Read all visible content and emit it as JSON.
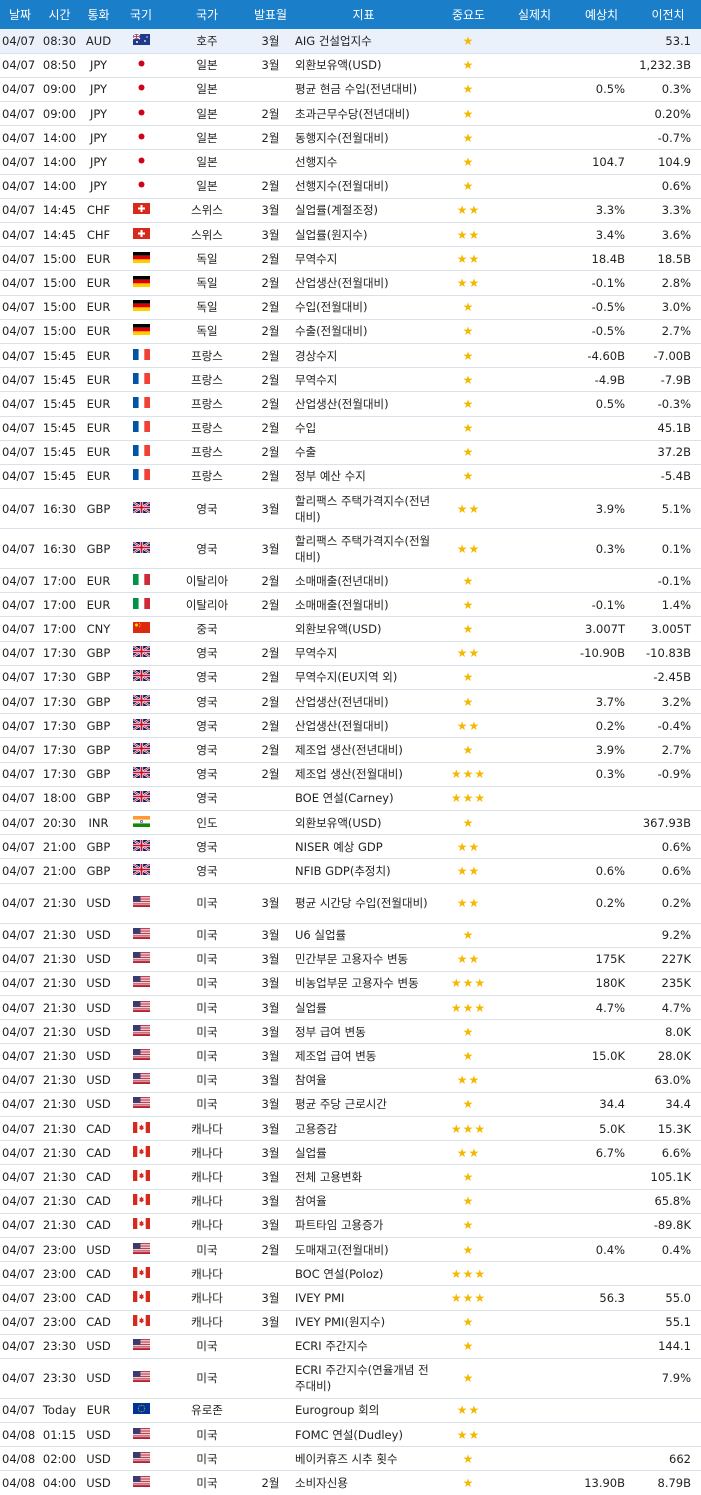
{
  "columns": [
    "날짜",
    "시간",
    "통화",
    "국기",
    "국가",
    "발표월",
    "지표",
    "중요도",
    "실제치",
    "예상치",
    "이전치"
  ],
  "flag_icons": {
    "AUD": "australia-flag-icon",
    "JPY": "japan-flag-icon",
    "CHF": "switzerland-flag-icon",
    "EUR_DE": "germany-flag-icon",
    "EUR_FR": "france-flag-icon",
    "GBP": "uk-flag-icon",
    "EUR_IT": "italy-flag-icon",
    "CNY": "china-flag-icon",
    "INR": "india-flag-icon",
    "USD": "usa-flag-icon",
    "CAD": "canada-flag-icon",
    "EUR_EU": "eu-flag-icon"
  },
  "rows": [
    {
      "date": "04/07",
      "time": "08:30",
      "cur": "AUD",
      "flag": "au",
      "country": "호주",
      "month": "3월",
      "ind": "AIG 건설업지수",
      "stars": 1,
      "actual": "",
      "forecast": "",
      "prev": "53.1",
      "hl": true
    },
    {
      "date": "04/07",
      "time": "08:50",
      "cur": "JPY",
      "flag": "jp",
      "country": "일본",
      "month": "3월",
      "ind": "외환보유액(USD)",
      "stars": 1,
      "actual": "",
      "forecast": "",
      "prev": "1,232.3B"
    },
    {
      "date": "04/07",
      "time": "09:00",
      "cur": "JPY",
      "flag": "jp",
      "country": "일본",
      "month": "",
      "ind": "평균 현금 수입(전년대비)",
      "stars": 1,
      "actual": "",
      "forecast": "0.5%",
      "prev": "0.3%"
    },
    {
      "date": "04/07",
      "time": "09:00",
      "cur": "JPY",
      "flag": "jp",
      "country": "일본",
      "month": "2월",
      "ind": "초과근무수당(전년대비)",
      "stars": 1,
      "actual": "",
      "forecast": "",
      "prev": "0.20%"
    },
    {
      "date": "04/07",
      "time": "14:00",
      "cur": "JPY",
      "flag": "jp",
      "country": "일본",
      "month": "2월",
      "ind": "동행지수(전월대비)",
      "stars": 1,
      "actual": "",
      "forecast": "",
      "prev": "-0.7%"
    },
    {
      "date": "04/07",
      "time": "14:00",
      "cur": "JPY",
      "flag": "jp",
      "country": "일본",
      "month": "",
      "ind": "선행지수",
      "stars": 1,
      "actual": "",
      "forecast": "104.7",
      "prev": "104.9"
    },
    {
      "date": "04/07",
      "time": "14:00",
      "cur": "JPY",
      "flag": "jp",
      "country": "일본",
      "month": "2월",
      "ind": "선행지수(전월대비)",
      "stars": 1,
      "actual": "",
      "forecast": "",
      "prev": "0.6%"
    },
    {
      "date": "04/07",
      "time": "14:45",
      "cur": "CHF",
      "flag": "ch",
      "country": "스위스",
      "month": "3월",
      "ind": "실업률(계절조정)",
      "stars": 2,
      "actual": "",
      "forecast": "3.3%",
      "prev": "3.3%"
    },
    {
      "date": "04/07",
      "time": "14:45",
      "cur": "CHF",
      "flag": "ch",
      "country": "스위스",
      "month": "3월",
      "ind": "실업률(원지수)",
      "stars": 2,
      "actual": "",
      "forecast": "3.4%",
      "prev": "3.6%"
    },
    {
      "date": "04/07",
      "time": "15:00",
      "cur": "EUR",
      "flag": "de",
      "country": "독일",
      "month": "2월",
      "ind": "무역수지",
      "stars": 2,
      "actual": "",
      "forecast": "18.4B",
      "prev": "18.5B"
    },
    {
      "date": "04/07",
      "time": "15:00",
      "cur": "EUR",
      "flag": "de",
      "country": "독일",
      "month": "2월",
      "ind": "산업생산(전월대비)",
      "stars": 2,
      "actual": "",
      "forecast": "-0.1%",
      "prev": "2.8%"
    },
    {
      "date": "04/07",
      "time": "15:00",
      "cur": "EUR",
      "flag": "de",
      "country": "독일",
      "month": "2월",
      "ind": "수입(전월대비)",
      "stars": 1,
      "actual": "",
      "forecast": "-0.5%",
      "prev": "3.0%"
    },
    {
      "date": "04/07",
      "time": "15:00",
      "cur": "EUR",
      "flag": "de",
      "country": "독일",
      "month": "2월",
      "ind": "수출(전월대비)",
      "stars": 1,
      "actual": "",
      "forecast": "-0.5%",
      "prev": "2.7%"
    },
    {
      "date": "04/07",
      "time": "15:45",
      "cur": "EUR",
      "flag": "fr",
      "country": "프랑스",
      "month": "2월",
      "ind": "경상수지",
      "stars": 1,
      "actual": "",
      "forecast": "-4.60B",
      "prev": "-7.00B"
    },
    {
      "date": "04/07",
      "time": "15:45",
      "cur": "EUR",
      "flag": "fr",
      "country": "프랑스",
      "month": "2월",
      "ind": "무역수지",
      "stars": 1,
      "actual": "",
      "forecast": "-4.9B",
      "prev": "-7.9B"
    },
    {
      "date": "04/07",
      "time": "15:45",
      "cur": "EUR",
      "flag": "fr",
      "country": "프랑스",
      "month": "2월",
      "ind": "산업생산(전월대비)",
      "stars": 1,
      "actual": "",
      "forecast": "0.5%",
      "prev": "-0.3%"
    },
    {
      "date": "04/07",
      "time": "15:45",
      "cur": "EUR",
      "flag": "fr",
      "country": "프랑스",
      "month": "2월",
      "ind": "수입",
      "stars": 1,
      "actual": "",
      "forecast": "",
      "prev": "45.1B"
    },
    {
      "date": "04/07",
      "time": "15:45",
      "cur": "EUR",
      "flag": "fr",
      "country": "프랑스",
      "month": "2월",
      "ind": "수출",
      "stars": 1,
      "actual": "",
      "forecast": "",
      "prev": "37.2B"
    },
    {
      "date": "04/07",
      "time": "15:45",
      "cur": "EUR",
      "flag": "fr",
      "country": "프랑스",
      "month": "2월",
      "ind": "정부 예산 수지",
      "stars": 1,
      "actual": "",
      "forecast": "",
      "prev": "-5.4B"
    },
    {
      "date": "04/07",
      "time": "16:30",
      "cur": "GBP",
      "flag": "gb",
      "country": "영국",
      "month": "3월",
      "ind": "할리팩스 주택가격지수(전년대비)",
      "stars": 2,
      "actual": "",
      "forecast": "3.9%",
      "prev": "5.1%",
      "tall": true
    },
    {
      "date": "04/07",
      "time": "16:30",
      "cur": "GBP",
      "flag": "gb",
      "country": "영국",
      "month": "3월",
      "ind": "할리팩스 주택가격지수(전월대비)",
      "stars": 2,
      "actual": "",
      "forecast": "0.3%",
      "prev": "0.1%",
      "tall": true
    },
    {
      "date": "04/07",
      "time": "17:00",
      "cur": "EUR",
      "flag": "it",
      "country": "이탈리아",
      "month": "2월",
      "ind": "소매매출(전년대비)",
      "stars": 1,
      "actual": "",
      "forecast": "",
      "prev": "-0.1%"
    },
    {
      "date": "04/07",
      "time": "17:00",
      "cur": "EUR",
      "flag": "it",
      "country": "이탈리아",
      "month": "2월",
      "ind": "소매매출(전월대비)",
      "stars": 1,
      "actual": "",
      "forecast": "-0.1%",
      "prev": "1.4%"
    },
    {
      "date": "04/07",
      "time": "17:00",
      "cur": "CNY",
      "flag": "cn",
      "country": "중국",
      "month": "",
      "ind": "외환보유액(USD)",
      "stars": 1,
      "actual": "",
      "forecast": "3.007T",
      "prev": "3.005T"
    },
    {
      "date": "04/07",
      "time": "17:30",
      "cur": "GBP",
      "flag": "gb",
      "country": "영국",
      "month": "2월",
      "ind": "무역수지",
      "stars": 2,
      "actual": "",
      "forecast": "-10.90B",
      "prev": "-10.83B"
    },
    {
      "date": "04/07",
      "time": "17:30",
      "cur": "GBP",
      "flag": "gb",
      "country": "영국",
      "month": "2월",
      "ind": "무역수지(EU지역 외)",
      "stars": 1,
      "actual": "",
      "forecast": "",
      "prev": "-2.45B"
    },
    {
      "date": "04/07",
      "time": "17:30",
      "cur": "GBP",
      "flag": "gb",
      "country": "영국",
      "month": "2월",
      "ind": "산업생산(전년대비)",
      "stars": 1,
      "actual": "",
      "forecast": "3.7%",
      "prev": "3.2%"
    },
    {
      "date": "04/07",
      "time": "17:30",
      "cur": "GBP",
      "flag": "gb",
      "country": "영국",
      "month": "2월",
      "ind": "산업생산(전월대비)",
      "stars": 2,
      "actual": "",
      "forecast": "0.2%",
      "prev": "-0.4%"
    },
    {
      "date": "04/07",
      "time": "17:30",
      "cur": "GBP",
      "flag": "gb",
      "country": "영국",
      "month": "2월",
      "ind": "제조업 생산(전년대비)",
      "stars": 1,
      "actual": "",
      "forecast": "3.9%",
      "prev": "2.7%"
    },
    {
      "date": "04/07",
      "time": "17:30",
      "cur": "GBP",
      "flag": "gb",
      "country": "영국",
      "month": "2월",
      "ind": "제조업 생산(전월대비)",
      "stars": 3,
      "actual": "",
      "forecast": "0.3%",
      "prev": "-0.9%"
    },
    {
      "date": "04/07",
      "time": "18:00",
      "cur": "GBP",
      "flag": "gb",
      "country": "영국",
      "month": "",
      "ind": "BOE 연설(Carney)",
      "stars": 3,
      "actual": "",
      "forecast": "",
      "prev": ""
    },
    {
      "date": "04/07",
      "time": "20:30",
      "cur": "INR",
      "flag": "in",
      "country": "인도",
      "month": "",
      "ind": "외환보유액(USD)",
      "stars": 1,
      "actual": "",
      "forecast": "",
      "prev": "367.93B"
    },
    {
      "date": "04/07",
      "time": "21:00",
      "cur": "GBP",
      "flag": "gb",
      "country": "영국",
      "month": "",
      "ind": "NISER 예상 GDP",
      "stars": 2,
      "actual": "",
      "forecast": "",
      "prev": "0.6%"
    },
    {
      "date": "04/07",
      "time": "21:00",
      "cur": "GBP",
      "flag": "gb",
      "country": "영국",
      "month": "",
      "ind": "NFIB GDP(추정치)",
      "stars": 2,
      "actual": "",
      "forecast": "0.6%",
      "prev": "0.6%"
    },
    {
      "date": "04/07",
      "time": "21:30",
      "cur": "USD",
      "flag": "us",
      "country": "미국",
      "month": "3월",
      "ind": "평균 시간당 수입(전월대비)",
      "stars": 2,
      "actual": "",
      "forecast": "0.2%",
      "prev": "0.2%",
      "tall": true
    },
    {
      "date": "04/07",
      "time": "21:30",
      "cur": "USD",
      "flag": "us",
      "country": "미국",
      "month": "3월",
      "ind": "U6 실업률",
      "stars": 1,
      "actual": "",
      "forecast": "",
      "prev": "9.2%"
    },
    {
      "date": "04/07",
      "time": "21:30",
      "cur": "USD",
      "flag": "us",
      "country": "미국",
      "month": "3월",
      "ind": "민간부문 고용자수 변동",
      "stars": 2,
      "actual": "",
      "forecast": "175K",
      "prev": "227K"
    },
    {
      "date": "04/07",
      "time": "21:30",
      "cur": "USD",
      "flag": "us",
      "country": "미국",
      "month": "3월",
      "ind": "비농업부문 고용자수 변동",
      "stars": 3,
      "actual": "",
      "forecast": "180K",
      "prev": "235K"
    },
    {
      "date": "04/07",
      "time": "21:30",
      "cur": "USD",
      "flag": "us",
      "country": "미국",
      "month": "3월",
      "ind": "실업률",
      "stars": 3,
      "actual": "",
      "forecast": "4.7%",
      "prev": "4.7%"
    },
    {
      "date": "04/07",
      "time": "21:30",
      "cur": "USD",
      "flag": "us",
      "country": "미국",
      "month": "3월",
      "ind": "정부 급여 변동",
      "stars": 1,
      "actual": "",
      "forecast": "",
      "prev": "8.0K"
    },
    {
      "date": "04/07",
      "time": "21:30",
      "cur": "USD",
      "flag": "us",
      "country": "미국",
      "month": "3월",
      "ind": "제조업 급여 변동",
      "stars": 1,
      "actual": "",
      "forecast": "15.0K",
      "prev": "28.0K"
    },
    {
      "date": "04/07",
      "time": "21:30",
      "cur": "USD",
      "flag": "us",
      "country": "미국",
      "month": "3월",
      "ind": "참여율",
      "stars": 2,
      "actual": "",
      "forecast": "",
      "prev": "63.0%"
    },
    {
      "date": "04/07",
      "time": "21:30",
      "cur": "USD",
      "flag": "us",
      "country": "미국",
      "month": "3월",
      "ind": "평균 주당 근로시간",
      "stars": 1,
      "actual": "",
      "forecast": "34.4",
      "prev": "34.4"
    },
    {
      "date": "04/07",
      "time": "21:30",
      "cur": "CAD",
      "flag": "ca",
      "country": "캐나다",
      "month": "3월",
      "ind": "고용증감",
      "stars": 3,
      "actual": "",
      "forecast": "5.0K",
      "prev": "15.3K"
    },
    {
      "date": "04/07",
      "time": "21:30",
      "cur": "CAD",
      "flag": "ca",
      "country": "캐나다",
      "month": "3월",
      "ind": "실업률",
      "stars": 2,
      "actual": "",
      "forecast": "6.7%",
      "prev": "6.6%"
    },
    {
      "date": "04/07",
      "time": "21:30",
      "cur": "CAD",
      "flag": "ca",
      "country": "캐나다",
      "month": "3월",
      "ind": "전체 고용변화",
      "stars": 1,
      "actual": "",
      "forecast": "",
      "prev": "105.1K"
    },
    {
      "date": "04/07",
      "time": "21:30",
      "cur": "CAD",
      "flag": "ca",
      "country": "캐나다",
      "month": "3월",
      "ind": "참여율",
      "stars": 1,
      "actual": "",
      "forecast": "",
      "prev": "65.8%"
    },
    {
      "date": "04/07",
      "time": "21:30",
      "cur": "CAD",
      "flag": "ca",
      "country": "캐나다",
      "month": "3월",
      "ind": "파트타임 고용증가",
      "stars": 1,
      "actual": "",
      "forecast": "",
      "prev": "-89.8K"
    },
    {
      "date": "04/07",
      "time": "23:00",
      "cur": "USD",
      "flag": "us",
      "country": "미국",
      "month": "2월",
      "ind": "도매재고(전월대비)",
      "stars": 1,
      "actual": "",
      "forecast": "0.4%",
      "prev": "0.4%"
    },
    {
      "date": "04/07",
      "time": "23:00",
      "cur": "CAD",
      "flag": "ca",
      "country": "캐나다",
      "month": "",
      "ind": "BOC 연설(Poloz)",
      "stars": 3,
      "actual": "",
      "forecast": "",
      "prev": ""
    },
    {
      "date": "04/07",
      "time": "23:00",
      "cur": "CAD",
      "flag": "ca",
      "country": "캐나다",
      "month": "3월",
      "ind": "IVEY PMI",
      "stars": 3,
      "actual": "",
      "forecast": "56.3",
      "prev": "55.0"
    },
    {
      "date": "04/07",
      "time": "23:00",
      "cur": "CAD",
      "flag": "ca",
      "country": "캐나다",
      "month": "3월",
      "ind": "IVEY PMI(원지수)",
      "stars": 1,
      "actual": "",
      "forecast": "",
      "prev": "55.1"
    },
    {
      "date": "04/07",
      "time": "23:30",
      "cur": "USD",
      "flag": "us",
      "country": "미국",
      "month": "",
      "ind": "ECRI 주간지수",
      "stars": 1,
      "actual": "",
      "forecast": "",
      "prev": "144.1"
    },
    {
      "date": "04/07",
      "time": "23:30",
      "cur": "USD",
      "flag": "us",
      "country": "미국",
      "month": "",
      "ind": "ECRI 주간지수(연율개념 전주대비)",
      "stars": 1,
      "actual": "",
      "forecast": "",
      "prev": "7.9%",
      "tall": true
    },
    {
      "date": "04/07",
      "time": "Today",
      "cur": "EUR",
      "flag": "eu",
      "country": "유로존",
      "month": "",
      "ind": "Eurogroup 회의",
      "stars": 2,
      "actual": "",
      "forecast": "",
      "prev": ""
    },
    {
      "date": "04/08",
      "time": "01:15",
      "cur": "USD",
      "flag": "us",
      "country": "미국",
      "month": "",
      "ind": "FOMC 연설(Dudley)",
      "stars": 2,
      "actual": "",
      "forecast": "",
      "prev": ""
    },
    {
      "date": "04/08",
      "time": "02:00",
      "cur": "USD",
      "flag": "us",
      "country": "미국",
      "month": "",
      "ind": "베이커휴즈 시추 횟수",
      "stars": 1,
      "actual": "",
      "forecast": "",
      "prev": "662"
    },
    {
      "date": "04/08",
      "time": "04:00",
      "cur": "USD",
      "flag": "us",
      "country": "미국",
      "month": "2월",
      "ind": "소비자신용",
      "stars": 1,
      "actual": "",
      "forecast": "13.90B",
      "prev": "8.79B"
    }
  ]
}
